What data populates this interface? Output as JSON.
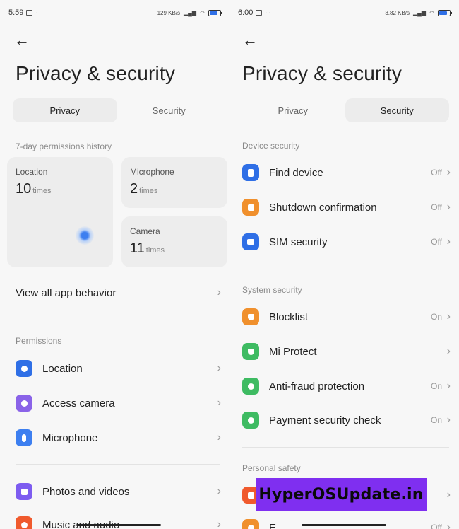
{
  "left": {
    "status": {
      "time": "5:59",
      "net": "129 KB/s"
    },
    "title": "Privacy & security",
    "tabs": [
      {
        "label": "Privacy",
        "active": true
      },
      {
        "label": "Security",
        "active": false
      }
    ],
    "history_label": "7-day permissions history",
    "cards": {
      "location": {
        "title": "Location",
        "value": "10",
        "unit": "times"
      },
      "microphone": {
        "title": "Microphone",
        "value": "2",
        "unit": "times"
      },
      "camera": {
        "title": "Camera",
        "value": "11",
        "unit": "times"
      }
    },
    "view_all": "View all app behavior",
    "permissions_label": "Permissions",
    "permissions": [
      {
        "label": "Location",
        "color": "#2f6fe6",
        "icon": "location-pin-icon"
      },
      {
        "label": "Access camera",
        "color": "#8a63e8",
        "icon": "camera-icon"
      },
      {
        "label": "Microphone",
        "color": "#3d7ff0",
        "icon": "microphone-icon"
      }
    ],
    "permissions2": [
      {
        "label": "Photos and videos",
        "color": "#7d5cf0",
        "icon": "photo-icon"
      },
      {
        "label": "Music and audio",
        "color": "#f05a2d",
        "icon": "music-icon"
      }
    ]
  },
  "right": {
    "status": {
      "time": "6:00",
      "net": "3.82 KB/s"
    },
    "title": "Privacy & security",
    "tabs": [
      {
        "label": "Privacy",
        "active": false
      },
      {
        "label": "Security",
        "active": true
      }
    ],
    "device_label": "Device security",
    "device": [
      {
        "label": "Find device",
        "status": "Off",
        "color": "#2f6fe6",
        "icon": "find-device-icon"
      },
      {
        "label": "Shutdown confirmation",
        "status": "Off",
        "color": "#f0902d",
        "icon": "lock-icon"
      },
      {
        "label": "SIM security",
        "status": "Off",
        "color": "#2f6fe6",
        "icon": "sim-card-icon"
      }
    ],
    "system_label": "System security",
    "system": [
      {
        "label": "Blocklist",
        "status": "On",
        "color": "#f0902d",
        "icon": "blocklist-shield-icon"
      },
      {
        "label": "Mi Protect",
        "status": "",
        "color": "#3ebb62",
        "icon": "mi-protect-icon"
      },
      {
        "label": "Anti-fraud protection",
        "status": "On",
        "color": "#3ebb62",
        "icon": "phone-shield-icon"
      },
      {
        "label": "Payment security check",
        "status": "On",
        "color": "#3ebb62",
        "icon": "payment-check-icon"
      }
    ],
    "personal_label": "Personal safety",
    "personal": [
      {
        "label": "",
        "status": "",
        "color": "#f05a2d",
        "icon": "emergency-icon"
      },
      {
        "label": "E",
        "status": "Off",
        "color": "#f0902d",
        "icon": "sos-icon"
      }
    ]
  },
  "watermark": "HyperOSUpdate.in"
}
